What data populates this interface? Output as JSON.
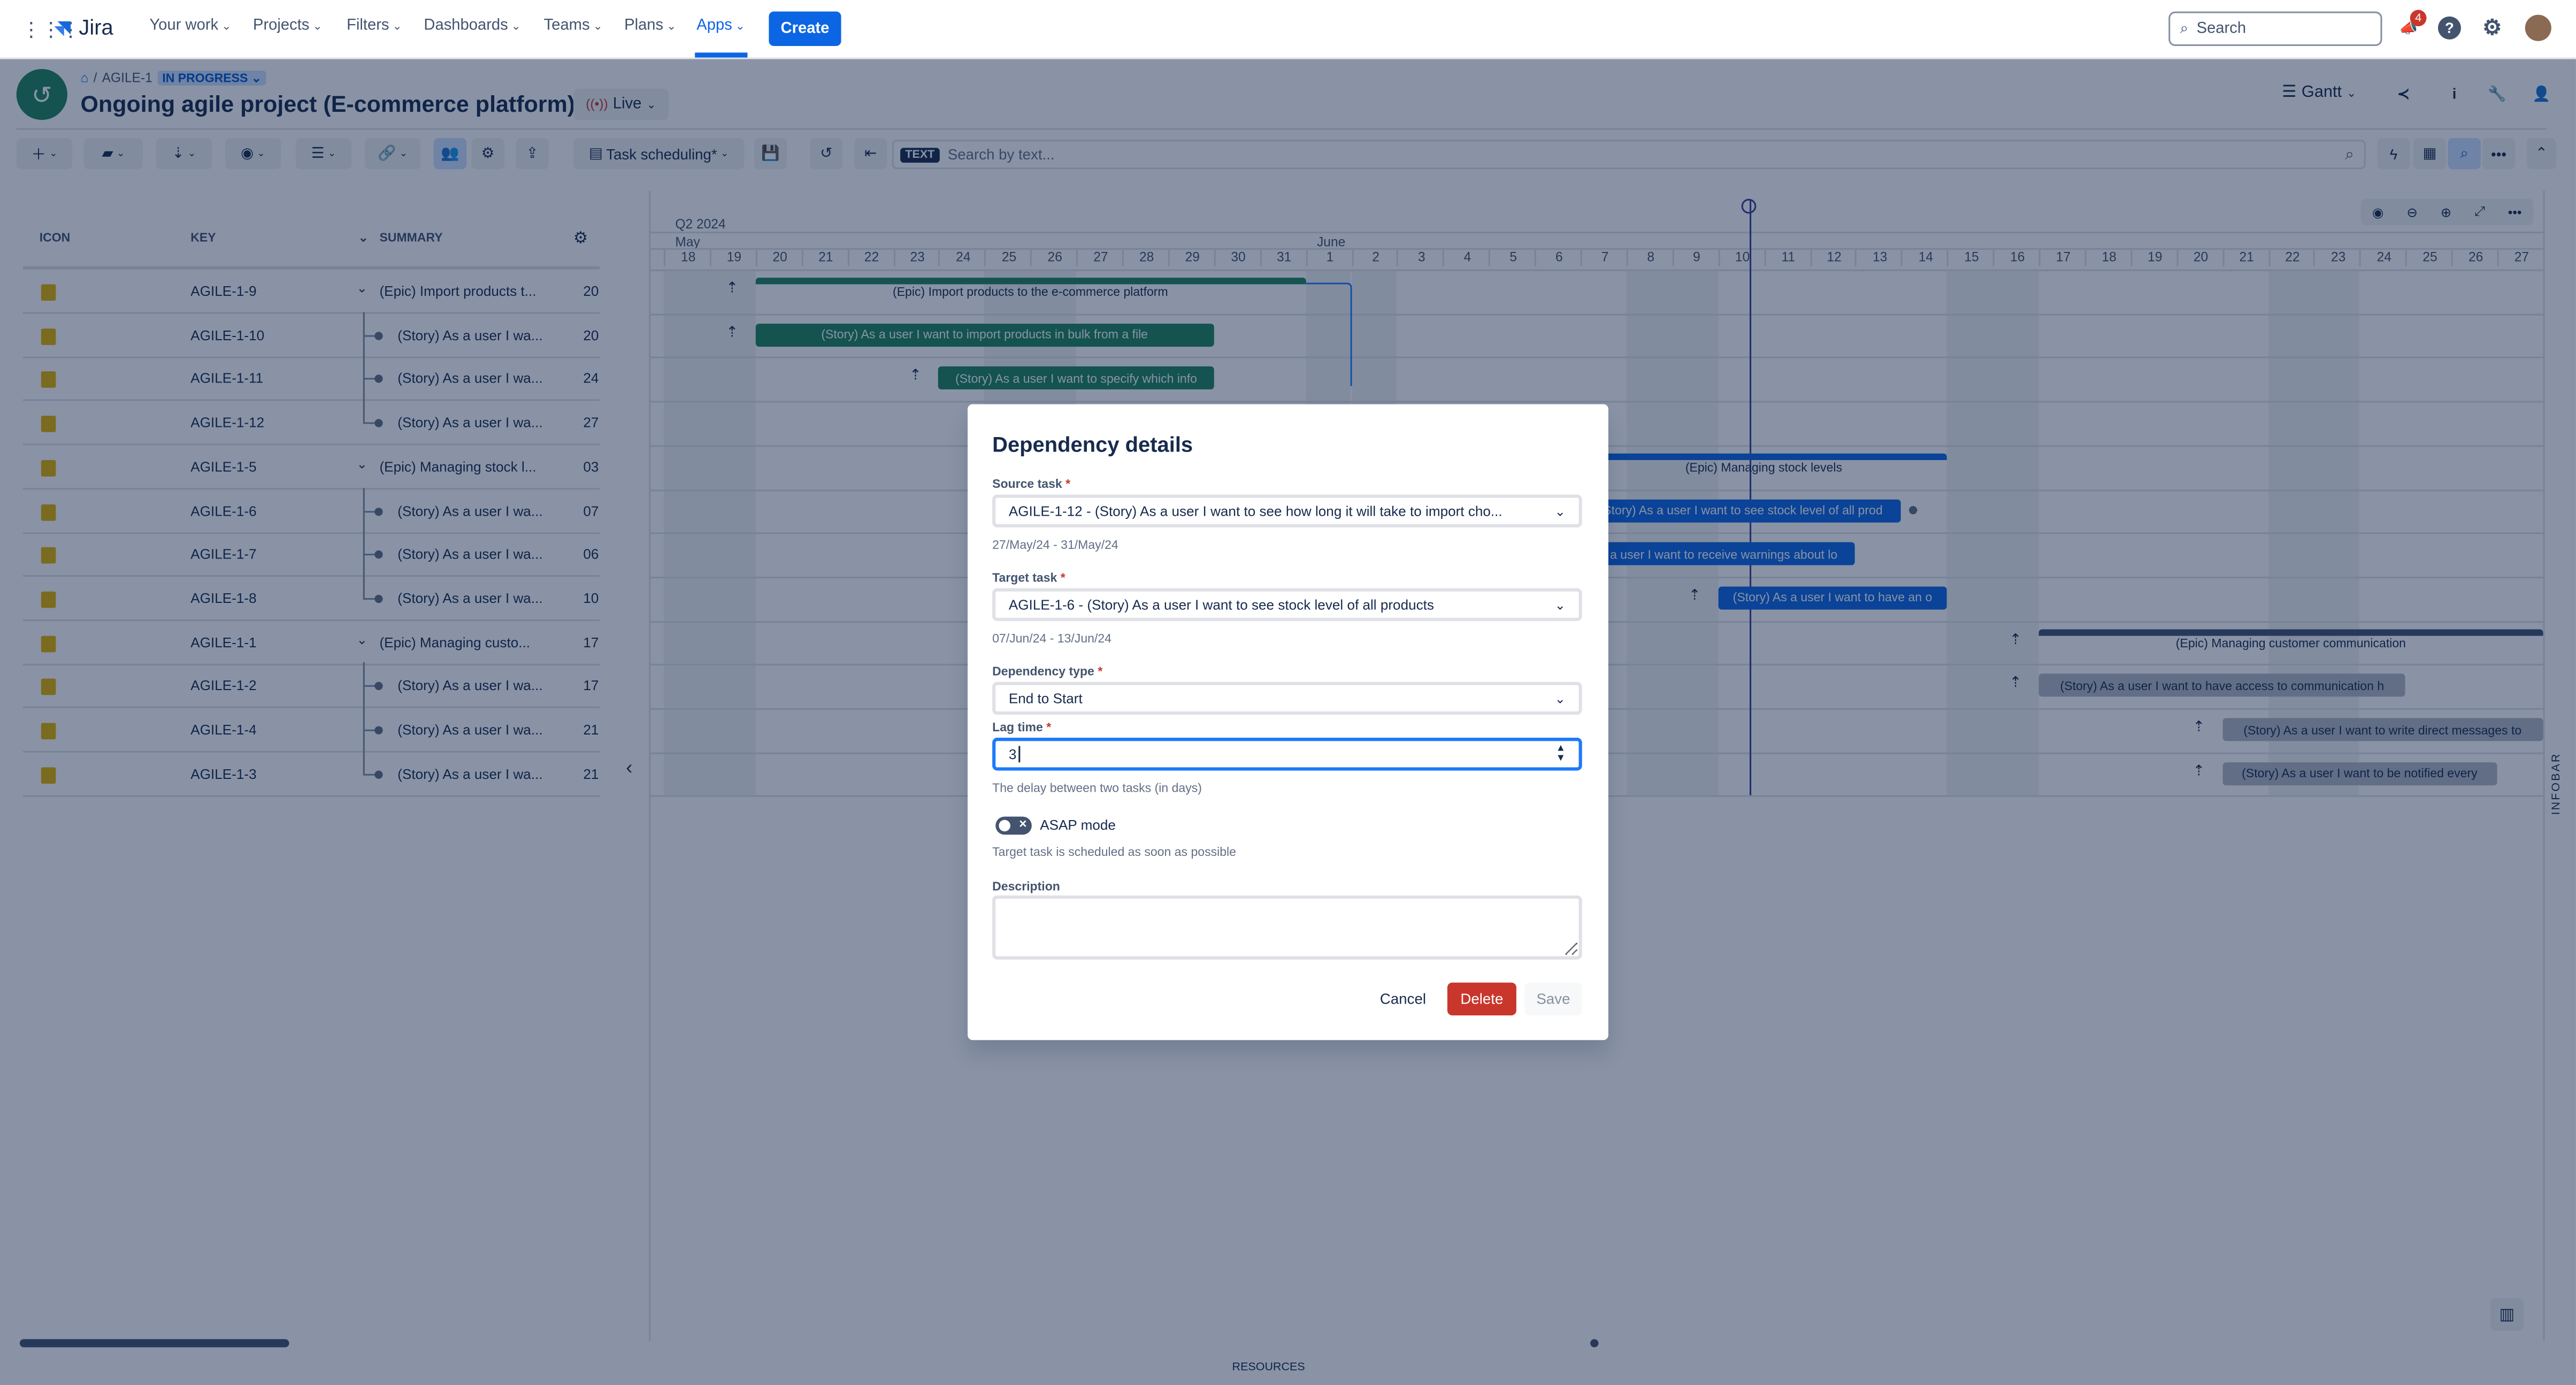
{
  "topnav": {
    "logo": "Jira",
    "items": [
      {
        "label": "Your work",
        "active": false
      },
      {
        "label": "Projects",
        "active": false
      },
      {
        "label": "Filters",
        "active": false
      },
      {
        "label": "Dashboards",
        "active": false
      },
      {
        "label": "Teams",
        "active": false
      },
      {
        "label": "Plans",
        "active": false
      },
      {
        "label": "Apps",
        "active": true
      }
    ],
    "create_label": "Create",
    "search_placeholder": "Search",
    "notification_count": "4",
    "icons": [
      "app-switcher-icon",
      "notifications-icon",
      "help-icon",
      "settings-icon",
      "profile-avatar"
    ]
  },
  "project": {
    "breadcrumb_key": "AGILE-1",
    "status": "IN PROGRESS",
    "title": "Ongoing agile project (E-commerce platform)",
    "live_label": "Live",
    "view_label": "Gantt"
  },
  "toolbar": {
    "view_name": "Task scheduling*",
    "text_tag": "TEXT",
    "search_placeholder": "Search by text..."
  },
  "table": {
    "headers": {
      "icon": "ICON",
      "key": "KEY",
      "summary": "SUMMARY"
    },
    "rows": [
      {
        "key": "AGILE-1-9",
        "summary": "(Epic) Import products t...",
        "date": "20",
        "type": "epic"
      },
      {
        "key": "AGILE-1-10",
        "summary": "(Story) As a user I wa...",
        "date": "20",
        "type": "story"
      },
      {
        "key": "AGILE-1-11",
        "summary": "(Story) As a user I wa...",
        "date": "24",
        "type": "story"
      },
      {
        "key": "AGILE-1-12",
        "summary": "(Story) As a user I wa...",
        "date": "27",
        "type": "story-last"
      },
      {
        "key": "AGILE-1-5",
        "summary": "(Epic) Managing stock l...",
        "date": "03",
        "type": "epic"
      },
      {
        "key": "AGILE-1-6",
        "summary": "(Story) As a user I wa...",
        "date": "07",
        "type": "story"
      },
      {
        "key": "AGILE-1-7",
        "summary": "(Story) As a user I wa...",
        "date": "06",
        "type": "story"
      },
      {
        "key": "AGILE-1-8",
        "summary": "(Story) As a user I wa...",
        "date": "10",
        "type": "story-last"
      },
      {
        "key": "AGILE-1-1",
        "summary": "(Epic) Managing custo...",
        "date": "17",
        "type": "epic"
      },
      {
        "key": "AGILE-1-2",
        "summary": "(Story) As a user I wa...",
        "date": "17",
        "type": "story"
      },
      {
        "key": "AGILE-1-4",
        "summary": "(Story) As a user I wa...",
        "date": "21",
        "type": "story"
      },
      {
        "key": "AGILE-1-3",
        "summary": "(Story) As a user I wa...",
        "date": "21",
        "type": "story-last"
      }
    ]
  },
  "gantt": {
    "quarter": "Q2 2024",
    "months": [
      {
        "label": "May",
        "startDay": 0
      },
      {
        "label": "June",
        "startDay": 14
      }
    ],
    "days": [
      "18",
      "19",
      "20",
      "21",
      "22",
      "23",
      "24",
      "25",
      "26",
      "27",
      "28",
      "29",
      "30",
      "31",
      "1",
      "2",
      "3",
      "4",
      "5",
      "6",
      "7",
      "8",
      "9",
      "10",
      "11",
      "12",
      "13",
      "14",
      "15",
      "16",
      "17",
      "18",
      "19",
      "20",
      "21",
      "22",
      "23",
      "24",
      "25",
      "26",
      "27"
    ],
    "weekends": [
      0,
      1,
      7,
      8,
      14,
      15,
      21,
      22,
      28,
      29,
      35,
      36
    ],
    "today_index": 24,
    "bars": [
      {
        "row": 0,
        "kind": "epic",
        "start": 2,
        "end": 14,
        "color": "#1f845a",
        "label": "(Epic) Import products to the e-commerce platform"
      },
      {
        "row": 1,
        "kind": "story",
        "start": 2,
        "end": 12,
        "color": "green",
        "label": "(Story) As a user I want to import products in bulk from a file"
      },
      {
        "row": 2,
        "kind": "story",
        "start": 6,
        "end": 12,
        "color": "green",
        "label": "(Story) As a user I want to specify which info"
      },
      {
        "row": 4,
        "kind": "epic",
        "start": 20,
        "end": 28,
        "color": "#0c66e4",
        "label": "(Epic) Managing stock levels"
      },
      {
        "row": 5,
        "kind": "story",
        "start": 20,
        "end": 27,
        "color": "blue",
        "label": "(Story) As a user I want to see stock level of all prod"
      },
      {
        "row": 6,
        "kind": "story",
        "start": 19,
        "end": 26,
        "color": "blue",
        "label": "(Story) As a user I want to receive warnings about lo"
      },
      {
        "row": 7,
        "kind": "story",
        "start": 23,
        "end": 28,
        "color": "blue",
        "label": "(Story) As a user I want to have an o"
      },
      {
        "row": 8,
        "kind": "epic",
        "start": 30,
        "end": 41,
        "color": "#44546f",
        "label": "(Epic) Managing customer communication"
      },
      {
        "row": 9,
        "kind": "story",
        "start": 30,
        "end": 38,
        "color": "grey",
        "label": "(Story) As a user I want to have access to communication h"
      },
      {
        "row": 10,
        "kind": "story",
        "start": 34,
        "end": 41,
        "color": "grey",
        "label": "(Story) As a user I want to write direct messages to"
      },
      {
        "row": 11,
        "kind": "story",
        "start": 34,
        "end": 40,
        "color": "grey",
        "label": "(Story) As a user I want to be notified every"
      }
    ],
    "milestone_arrows": [
      {
        "row": 0,
        "day": 1
      },
      {
        "row": 1,
        "day": 1
      },
      {
        "row": 2,
        "day": 5
      },
      {
        "row": 7,
        "day": 22
      },
      {
        "row": 8,
        "day": 29
      },
      {
        "row": 9,
        "day": 29
      },
      {
        "row": 10,
        "day": 33
      },
      {
        "row": 11,
        "day": 33
      }
    ],
    "infobar_label": "INFOBAR",
    "resources_label": "RESOURCES"
  },
  "modal": {
    "title": "Dependency details",
    "source_label": "Source task",
    "source_value": "AGILE-1-12 - (Story) As a user I want to see how long it will take to import cho...",
    "source_dates": "27/May/24 - 31/May/24",
    "target_label": "Target task",
    "target_value": "AGILE-1-6 - (Story) As a user I want to see stock level of all products",
    "target_dates": "07/Jun/24 - 13/Jun/24",
    "type_label": "Dependency type",
    "type_value": "End to Start",
    "lag_label": "Lag time",
    "lag_value": "3",
    "lag_hint": "The delay between two tasks (in days)",
    "asap_label": "ASAP mode",
    "asap_enabled": false,
    "asap_hint": "Target task is scheduled as soon as possible",
    "description_label": "Description",
    "description_value": "",
    "cancel_label": "Cancel",
    "delete_label": "Delete",
    "save_label": "Save",
    "required_mark": "*"
  }
}
